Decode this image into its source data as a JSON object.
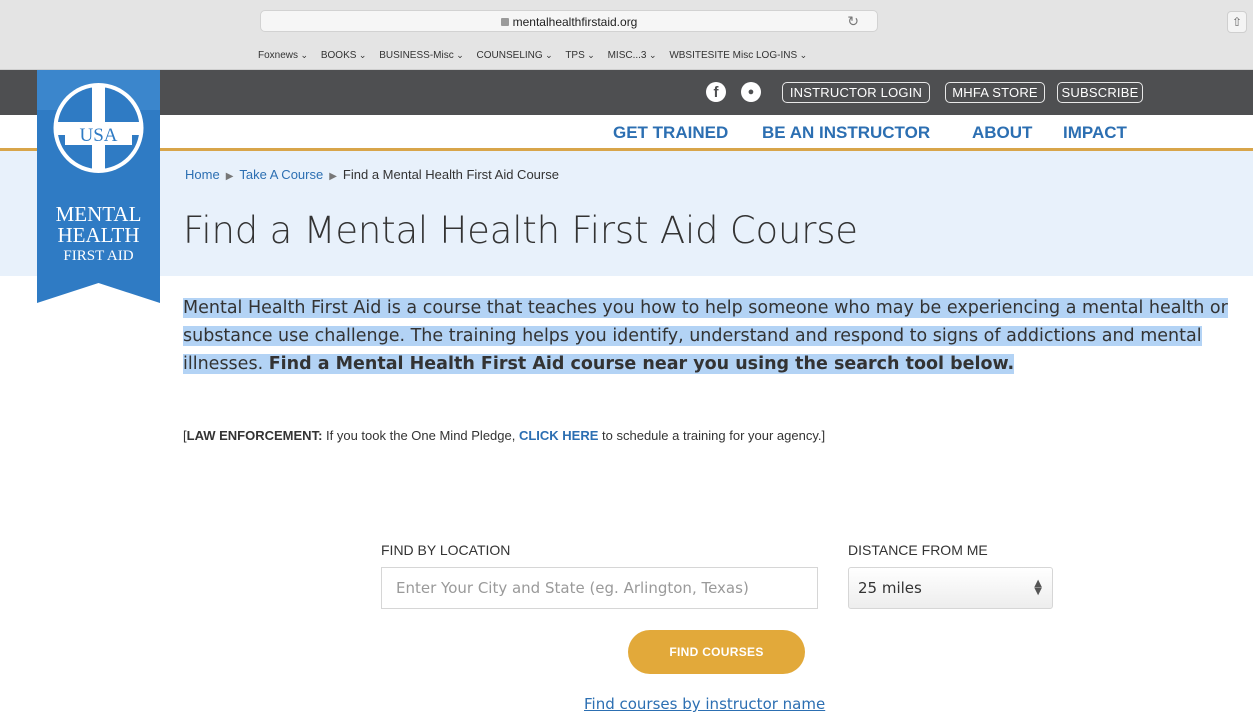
{
  "browser": {
    "url": "mentalhealthfirstaid.org",
    "bookmarks": [
      "Foxnews",
      "BOOKS",
      "BUSINESS-Misc",
      "COUNSELING",
      "TPS",
      "MISC...3",
      "WBSITESITE Misc LOG-INS"
    ]
  },
  "topbar": {
    "social": [
      "facebook-icon",
      "twitter-icon"
    ],
    "instructor_login": "INSTRUCTOR LOGIN",
    "store": "MHFA STORE",
    "subscribe": "SUBSCRIBE"
  },
  "logo": {
    "country": "USA",
    "line1": "MENTAL",
    "line2": "HEALTH",
    "line3": "FIRST AID"
  },
  "nav": {
    "get_trained": "GET TRAINED",
    "be_instructor": "BE AN INSTRUCTOR",
    "about": "ABOUT",
    "impact": "IMPACT"
  },
  "breadcrumb": {
    "home": "Home",
    "take_course": "Take A Course",
    "current": "Find a Mental Health First Aid Course"
  },
  "page": {
    "title": "Find a Mental Health First Aid Course",
    "intro_plain": "Mental Health First Aid is a course that teaches you how to help someone who may be experiencing a mental health or substance use challenge. The training helps you identify, understand and respond to signs of addictions and mental illnesses. ",
    "intro_bold": "Find a Mental Health First Aid course near you using the search tool below.",
    "law_prefix": "[",
    "law_label": "LAW ENFORCEMENT:",
    "law_text1": " If you took the One Mind Pledge, ",
    "law_link": "CLICK HERE",
    "law_text2": " to schedule a training for your agency.]"
  },
  "search": {
    "location_label": "FIND BY LOCATION",
    "location_placeholder": "Enter Your City and State (eg. Arlington, Texas)",
    "distance_label": "DISTANCE FROM ME",
    "distance_value": "25 miles",
    "submit": "FIND COURSES",
    "instructor_link": "Find courses by instructor name"
  },
  "colors": {
    "brand_blue": "#2c6fb2",
    "topbar_gray": "#4e4f51",
    "accent_gold": "#e2a93a",
    "hero_bg": "#e8f1fb",
    "selection_blue": "#b3d3f5"
  }
}
